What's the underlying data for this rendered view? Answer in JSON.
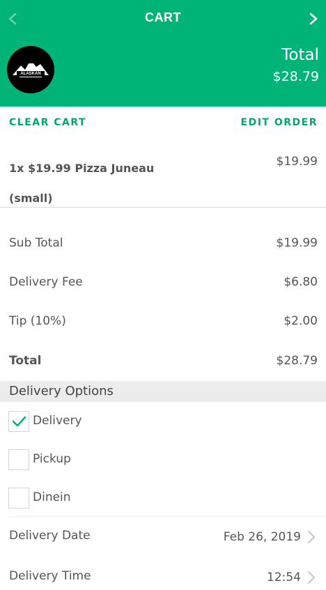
{
  "header": {
    "title": "CART",
    "total_label": "Total",
    "total_value": "$28.79",
    "logo_text": "ALASKAN"
  },
  "actions": {
    "clear_cart": "CLEAR CART",
    "edit_order": "EDIT ORDER"
  },
  "item": {
    "line1": "1x $19.99 Pizza Juneau",
    "line2": "(small)",
    "price": "$19.99"
  },
  "summary": {
    "subtotal_label": "Sub Total",
    "subtotal_value": "$19.99",
    "delivery_fee_label": "Delivery Fee",
    "delivery_fee_value": "$6.80",
    "tip_label": "Tip (10%)",
    "tip_value": "$2.00",
    "total_label": "Total",
    "total_value": "$28.79"
  },
  "delivery_options": {
    "title": "Delivery Options",
    "options": [
      {
        "label": "Delivery",
        "checked": true
      },
      {
        "label": "Pickup",
        "checked": false
      },
      {
        "label": "Dinein",
        "checked": false
      }
    ]
  },
  "details": {
    "date_label": "Delivery Date",
    "date_value": "Feb 26, 2019",
    "time_label": "Delivery Time",
    "time_value": "12:54"
  },
  "colors": {
    "brand": "#00b377",
    "accent": "#00a86b"
  }
}
